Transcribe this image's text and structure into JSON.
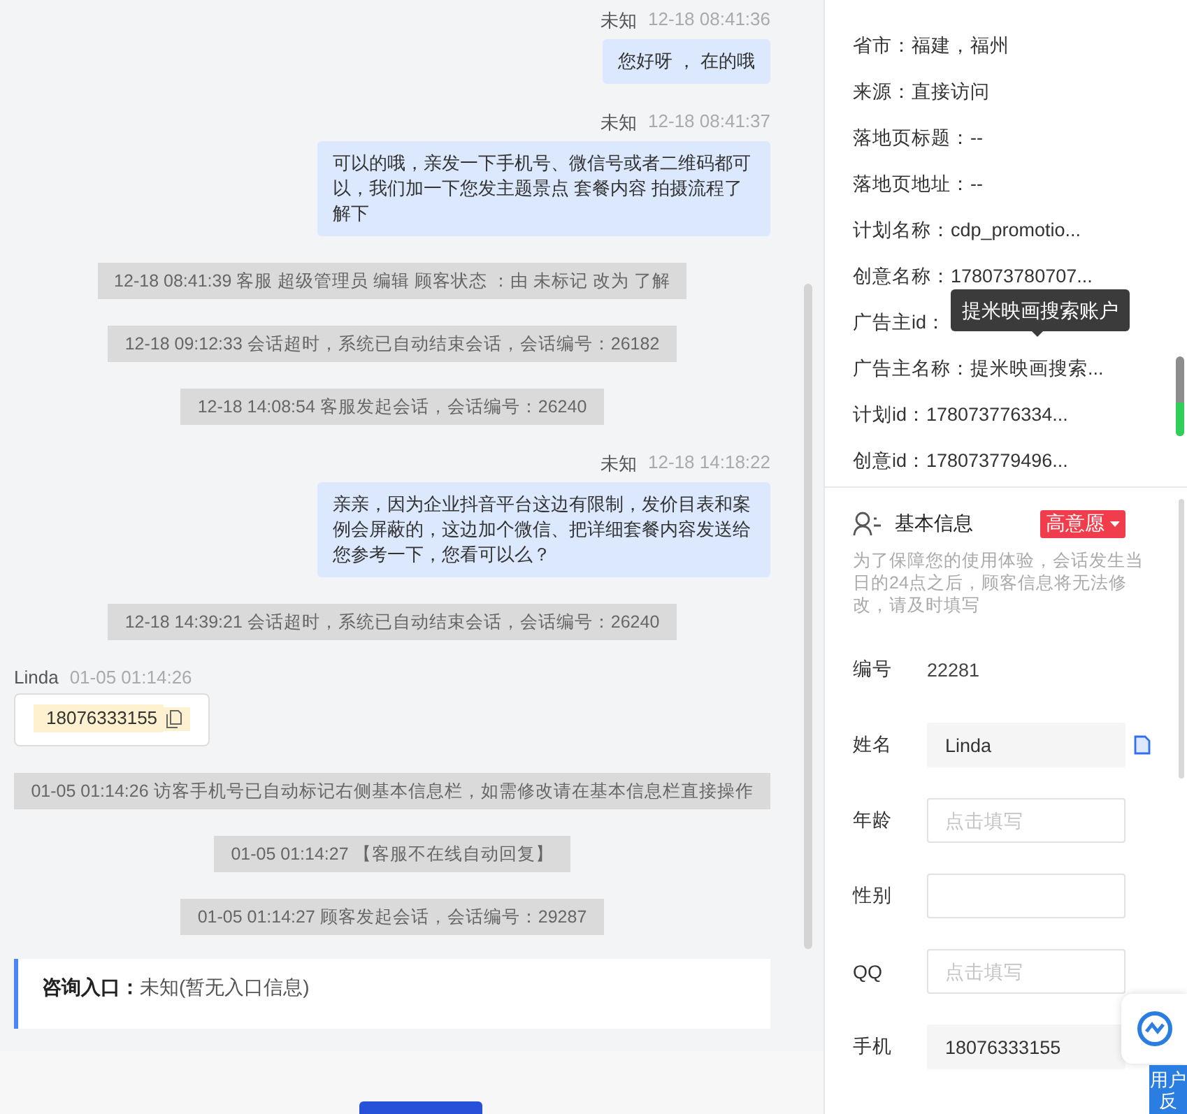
{
  "chat": {
    "messages": [
      {
        "kind": "sent",
        "sender": "未知",
        "time": "12-18 08:41:36",
        "text": "您好呀 ， 在的哦"
      },
      {
        "kind": "sent",
        "sender": "未知",
        "time": "12-18 08:41:37",
        "text": "可以的哦，亲发一下手机号、微信号或者二维码都可以，我们加一下您发主题景点 套餐内容 拍摄流程了解下"
      },
      {
        "kind": "system",
        "text": "12-18 08:41:39 客服 超级管理员 编辑 顾客状态 ：由 未标记 改为 了解"
      },
      {
        "kind": "system",
        "text": "12-18 09:12:33 会话超时，系统已自动结束会话，会话编号：26182"
      },
      {
        "kind": "system",
        "text": "12-18 14:08:54 客服发起会话，会话编号：26240"
      },
      {
        "kind": "sent",
        "sender": "未知",
        "time": "12-18 14:18:22",
        "text": "亲亲，因为企业抖音平台这边有限制，发价目表和案例会屏蔽的，这边加个微信、把详细套餐内容发送给您参考一下，您看可以么？"
      },
      {
        "kind": "system",
        "text": "12-18 14:39:21 会话超时，系统已自动结束会话，会话编号：26240"
      },
      {
        "kind": "received",
        "sender": "Linda",
        "time": "01-05 01:14:26",
        "text": "18076333155"
      },
      {
        "kind": "system",
        "text": "01-05 01:14:26 访客手机号已自动标记右侧基本信息栏，如需修改请在基本信息栏直接操作"
      },
      {
        "kind": "system",
        "text": "01-05 01:14:27 【客服不在线自动回复】"
      },
      {
        "kind": "system",
        "text": "01-05 01:14:27 顾客发起会话，会话编号：29287"
      },
      {
        "kind": "info",
        "label": "咨询入口：",
        "value": "未知(暂无入口信息)"
      }
    ]
  },
  "visitor_details": [
    "省市：福建，福州",
    "来源：直接访问",
    "落地页标题：--",
    "落地页地址：--",
    "计划名称：cdp_promotio...",
    "创意名称：178073780707...",
    "广告主id：",
    "广告主名称：提米映画搜索...",
    "计划id：178073776334...",
    "创意id：178073779496..."
  ],
  "tooltip": "提米映画搜索账户",
  "basic_info": {
    "title": "基本信息",
    "intent_badge": "高意愿",
    "note": "为了保障您的使用体验，会话发生当日的24点之后，顾客信息将无法修改，请及时填写",
    "fields": [
      {
        "label": "编号",
        "kind": "text",
        "value": "22281"
      },
      {
        "label": "姓名",
        "kind": "filled",
        "value": "Linda",
        "copyable": true
      },
      {
        "label": "年龄",
        "kind": "input",
        "placeholder": "点击填写"
      },
      {
        "label": "性别",
        "kind": "input"
      },
      {
        "label": "QQ",
        "kind": "input",
        "placeholder": "点击填写"
      },
      {
        "label": "手机",
        "kind": "filled",
        "value": "18076333155"
      }
    ]
  },
  "feedback_tab": "用户反"
}
